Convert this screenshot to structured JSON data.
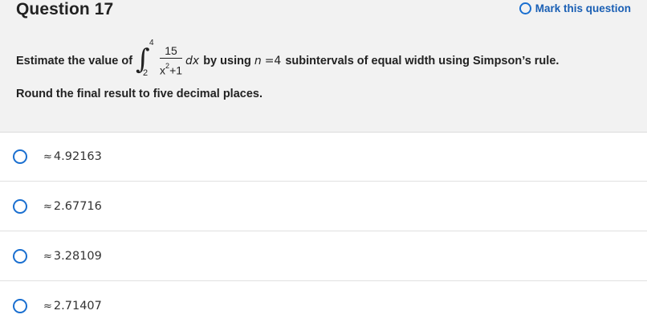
{
  "question": {
    "title": "Question 17",
    "mark_label": "Mark this question",
    "prompt_prefix": "Estimate the value of",
    "integral": {
      "lower": "2",
      "upper": "4",
      "numerator": "15",
      "denominator_base": "x",
      "denominator_exp": "2",
      "denominator_rest": "+1",
      "differential": "dx"
    },
    "prompt_mid": "by using",
    "n_var": "n",
    "n_value": "=4",
    "prompt_suffix": "subintervals of equal width using Simpson’s rule.",
    "instruction": "Round the final result to five decimal places."
  },
  "options": [
    {
      "approx": "≈",
      "value": "4.92163"
    },
    {
      "approx": "≈",
      "value": "2.67716"
    },
    {
      "approx": "≈",
      "value": "3.28109"
    },
    {
      "approx": "≈",
      "value": "2.71407"
    }
  ],
  "colors": {
    "accent": "#1a6fd0",
    "header_bg": "#f2f2f2"
  }
}
